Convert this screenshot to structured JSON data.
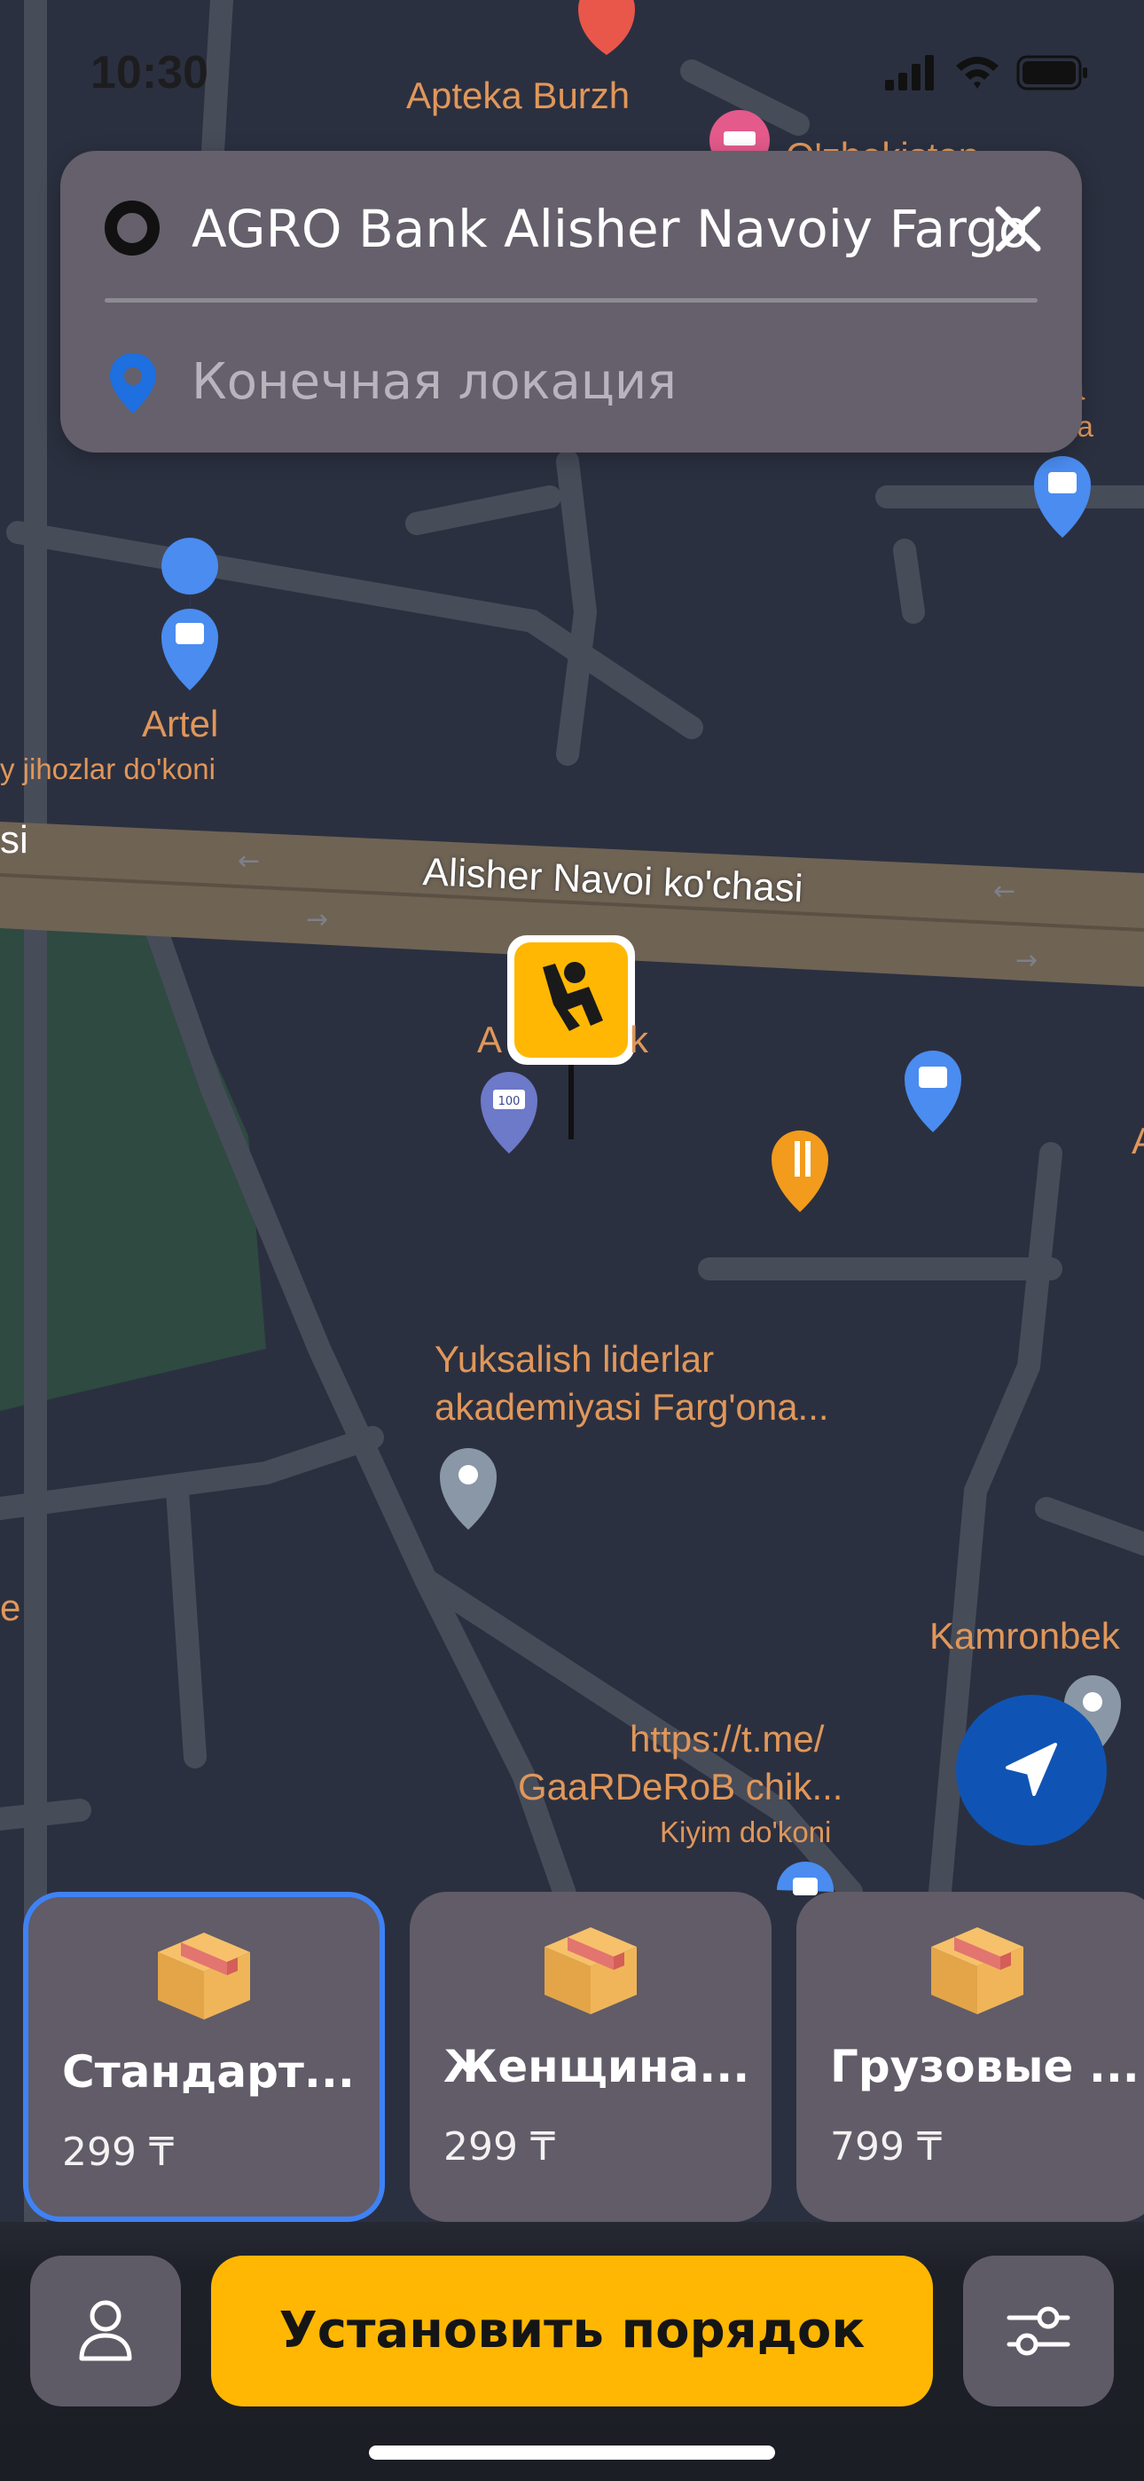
{
  "status_bar": {
    "time": "10:30"
  },
  "search": {
    "from_value": "AGRO Bank Alisher Navoiy Fargona",
    "to_placeholder": "Конечная локация"
  },
  "map": {
    "street_label": "Alisher Navoi ko'chasi",
    "street_label_left": "si",
    "labels": {
      "apteka": "Apteka Burzh",
      "uzbekistan": "O'zbekiston",
      "artel": "Artel",
      "artel_sub": "y jihozlar do'koni",
      "ab_left": "A",
      "ab_right": "k",
      "yuksalish1": "Yuksalish liderlar",
      "yuksalish2": "akademiyasi Farg'ona...",
      "kamronbek": "Kamronbek",
      "tme1": "https://t.me/",
      "tme2": "GaaRDeRoB chik...",
      "tme3": "Kiyim do'koni",
      "edge_e": "e",
      "edge_a": "a",
      "edge_ka": "ka",
      "edge_A": "A"
    },
    "bank_pin_text": "100"
  },
  "tariffs": [
    {
      "name": "Стандарт...",
      "price": "299 ₸",
      "icon": "package-icon"
    },
    {
      "name": "Женщина...",
      "price": "299 ₸",
      "icon": "package-icon"
    },
    {
      "name": "Грузовые ...",
      "price": "799 ₸",
      "icon": "package-icon"
    }
  ],
  "actions": {
    "main_label": "Установить порядок",
    "profile_icon": "user-icon",
    "filters_icon": "sliders-icon",
    "location_icon": "navigation-arrow-icon"
  },
  "colors": {
    "accent": "#ffb703",
    "map_bg": "#2b3040",
    "road": "#4a4f5c",
    "selected_border": "#3f82f5",
    "location_button": "#0f54b5"
  }
}
